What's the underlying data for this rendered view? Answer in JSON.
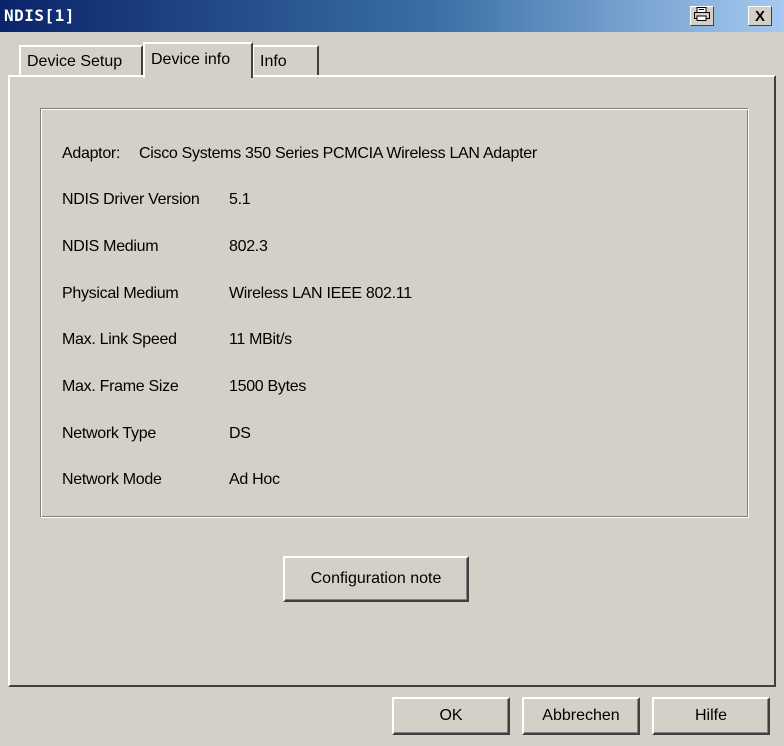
{
  "window": {
    "title": "NDIS[1]",
    "print_icon": "printer-icon",
    "close_label": "X"
  },
  "tabs": [
    {
      "label": "Device Setup",
      "active": false
    },
    {
      "label": "Device info",
      "active": true
    },
    {
      "label": "Info",
      "active": false
    }
  ],
  "device_info": {
    "adaptor_label": "Adaptor:",
    "adaptor_value": "Cisco Systems 350 Series PCMCIA Wireless LAN Adapter",
    "rows": [
      {
        "label": "NDIS Driver Version",
        "value": "5.1"
      },
      {
        "label": "NDIS Medium",
        "value": "802.3"
      },
      {
        "label": "Physical Medium",
        "value": "Wireless LAN IEEE 802.11"
      },
      {
        "label": "Max. Link Speed",
        "value": "11 MBit/s"
      },
      {
        "label": "Max. Frame Size",
        "value": "1500 Bytes"
      },
      {
        "label": "Network Type",
        "value": "DS"
      },
      {
        "label": "Network Mode",
        "value": "Ad Hoc"
      }
    ]
  },
  "config_button": "Configuration note",
  "footer": {
    "ok": "OK",
    "cancel": "Abbrechen",
    "help": "Hilfe"
  },
  "colors": {
    "face": "#d4d0c8",
    "title_start": "#0a246a",
    "title_end": "#a6caf0"
  }
}
